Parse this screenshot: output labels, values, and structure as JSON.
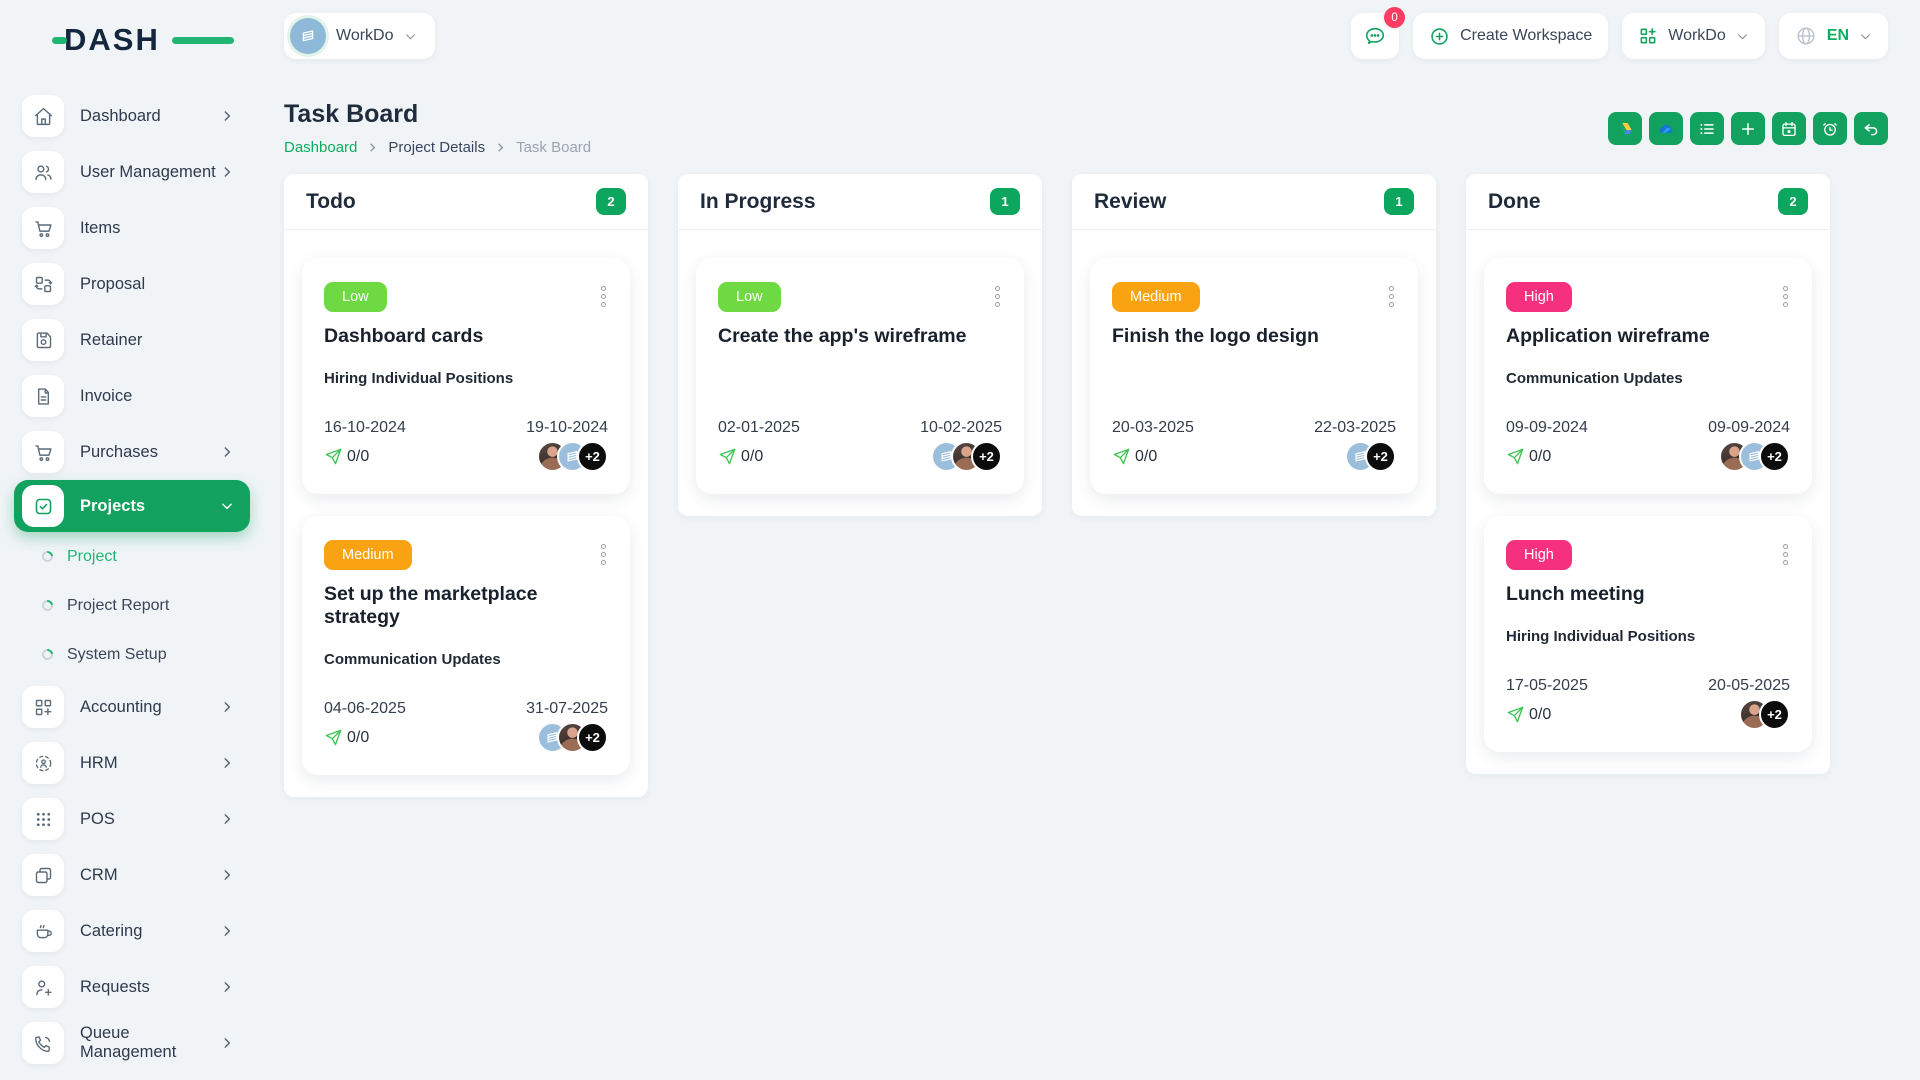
{
  "app": {
    "logo_text": "DASH"
  },
  "topbar": {
    "workspace_name": "WorkDo",
    "messages_badge": "0",
    "create_workspace_label": "Create Workspace",
    "app_switcher_label": "WorkDo",
    "language_label": "EN"
  },
  "sidebar": {
    "items": [
      {
        "label": "Dashboard"
      },
      {
        "label": "User Management"
      },
      {
        "label": "Items"
      },
      {
        "label": "Proposal"
      },
      {
        "label": "Retainer"
      },
      {
        "label": "Invoice"
      },
      {
        "label": "Purchases"
      },
      {
        "label": "Projects",
        "active": true,
        "expanded": true
      },
      {
        "label": "Accounting"
      },
      {
        "label": "HRM"
      },
      {
        "label": "POS"
      },
      {
        "label": "CRM"
      },
      {
        "label": "Catering"
      },
      {
        "label": "Requests"
      },
      {
        "label": "Queue Management"
      }
    ],
    "projects_submenu": [
      {
        "label": "Project",
        "active": true
      },
      {
        "label": "Project Report",
        "active": false
      },
      {
        "label": "System Setup",
        "active": false
      }
    ]
  },
  "page": {
    "title": "Task Board",
    "breadcrumb": [
      "Dashboard",
      "Project Details",
      "Task Board"
    ]
  },
  "toolbar": {
    "buttons": [
      "google-drive",
      "onedrive",
      "task-list",
      "add-task",
      "calendar",
      "timer",
      "back"
    ]
  },
  "board": {
    "columns": [
      {
        "title": "Todo",
        "count": "2",
        "cards": [
          {
            "priority": "Low",
            "title": "Dashboard cards",
            "project": "Hiring Individual Positions",
            "start_date": "16-10-2024",
            "end_date": "19-10-2024",
            "progress": "0/0",
            "extra_members": "+2",
            "avatars": [
              "person",
              "building"
            ]
          },
          {
            "priority": "Medium",
            "title": "Set up the marketplace strategy",
            "project": "Communication Updates",
            "start_date": "04-06-2025",
            "end_date": "31-07-2025",
            "progress": "0/0",
            "extra_members": "+2",
            "avatars": [
              "building",
              "person"
            ]
          }
        ]
      },
      {
        "title": "In Progress",
        "count": "1",
        "cards": [
          {
            "priority": "Low",
            "title": "Create the app's wireframe",
            "project": "",
            "start_date": "02-01-2025",
            "end_date": "10-02-2025",
            "progress": "0/0",
            "extra_members": "+2",
            "avatars": [
              "building",
              "person"
            ]
          }
        ]
      },
      {
        "title": "Review",
        "count": "1",
        "cards": [
          {
            "priority": "Medium",
            "title": "Finish the logo design",
            "project": "",
            "start_date": "20-03-2025",
            "end_date": "22-03-2025",
            "progress": "0/0",
            "extra_members": "+2",
            "avatars": [
              "building"
            ]
          }
        ]
      },
      {
        "title": "Done",
        "count": "2",
        "cards": [
          {
            "priority": "High",
            "title": "Application wireframe",
            "project": "Communication Updates",
            "start_date": "09-09-2024",
            "end_date": "09-09-2024",
            "progress": "0/0",
            "extra_members": "+2",
            "avatars": [
              "person",
              "building"
            ]
          },
          {
            "priority": "High",
            "title": "Lunch meeting",
            "project": "Hiring Individual Positions",
            "start_date": "17-05-2025",
            "end_date": "20-05-2025",
            "progress": "0/0",
            "extra_members": "+2",
            "avatars": [
              "person"
            ]
          }
        ]
      }
    ]
  },
  "colors": {
    "primary_green": "#12a15e",
    "link_green": "#0caf60",
    "priority_low": "#6fd943",
    "priority_medium": "#f9a312",
    "priority_high": "#f5317f",
    "notification_red": "#fd3c64",
    "page_background": "#f0f4f7"
  }
}
